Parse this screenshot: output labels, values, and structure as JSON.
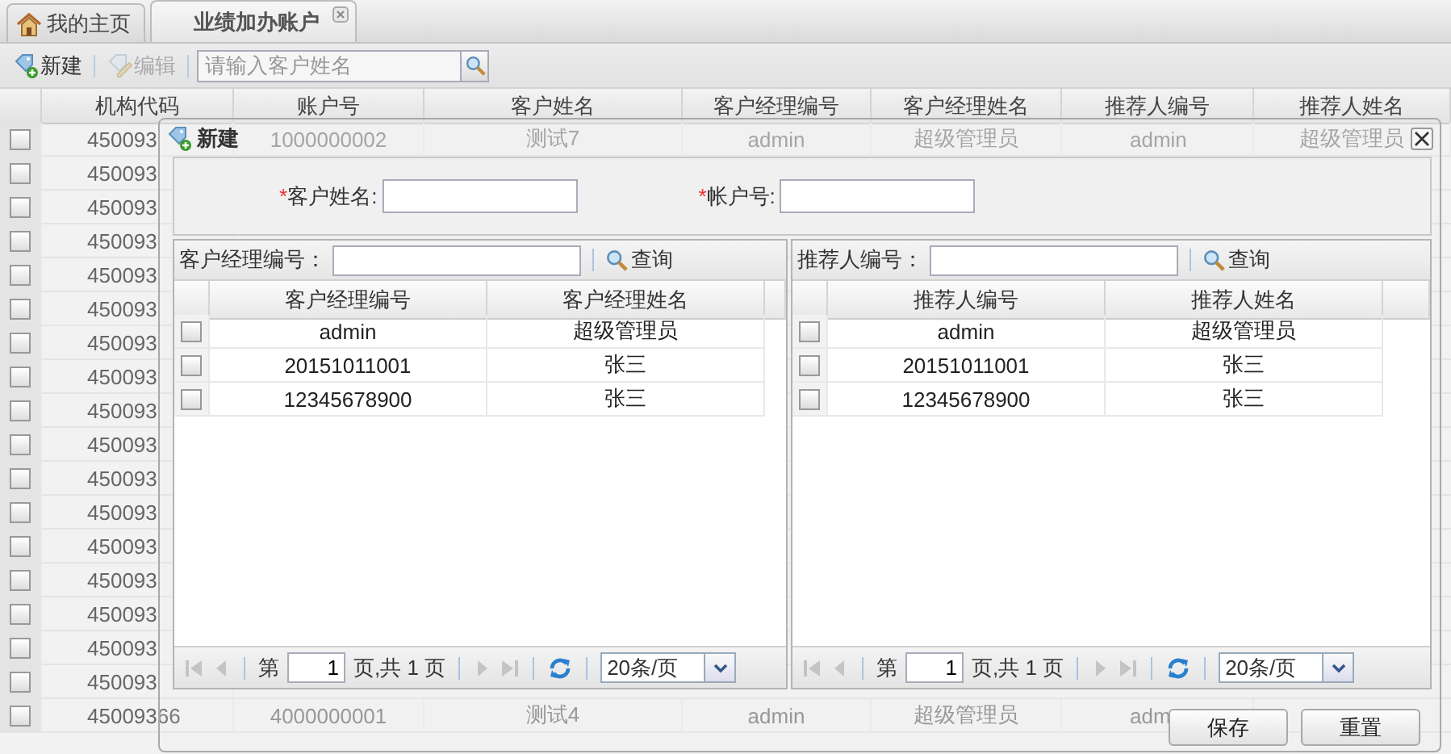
{
  "tabs": [
    {
      "label": "我的主页",
      "selected": false,
      "closable": false
    },
    {
      "label": "业绩加办账户",
      "selected": true,
      "closable": true
    }
  ],
  "toolbar": {
    "buttons": [
      {
        "label": "新建",
        "disabled": false
      },
      {
        "label": "编辑",
        "disabled": true
      }
    ],
    "search": {
      "placeholder": "请输入客户姓名"
    }
  },
  "grid": {
    "columns": [
      "机构代码",
      "账户号",
      "客户姓名",
      "客户经理编号",
      "客户经理姓名",
      "推荐人编号",
      "推荐人姓名"
    ],
    "rows": [
      {
        "checked": false,
        "cells": [
          "450093",
          "1000000002",
          "测试7",
          "admin",
          "超级管理员",
          "admin",
          "超级管理员"
        ]
      },
      {
        "checked": false,
        "cells": [
          "450093"
        ]
      },
      {
        "checked": false,
        "cells": [
          "450093"
        ]
      },
      {
        "checked": false,
        "cells": [
          "450093"
        ]
      },
      {
        "checked": false,
        "cells": [
          "450093"
        ]
      },
      {
        "checked": false,
        "cells": [
          "450093"
        ]
      },
      {
        "checked": false,
        "cells": [
          "450093"
        ]
      },
      {
        "checked": false,
        "cells": [
          "450093"
        ]
      },
      {
        "checked": false,
        "cells": [
          "450093"
        ]
      },
      {
        "checked": false,
        "cells": [
          "450093"
        ]
      },
      {
        "checked": false,
        "cells": [
          "450093"
        ]
      },
      {
        "checked": false,
        "cells": [
          "450093"
        ]
      },
      {
        "checked": false,
        "cells": [
          "450093"
        ]
      },
      {
        "checked": false,
        "cells": [
          "450093"
        ]
      },
      {
        "checked": false,
        "cells": [
          "450093"
        ]
      },
      {
        "checked": false,
        "cells": [
          "450093"
        ]
      },
      {
        "checked": false,
        "cells": [
          "450093"
        ]
      },
      {
        "checked": false,
        "cells": [
          "45009366",
          "4000000001",
          "测试4",
          "admin",
          "超级管理员",
          "adm"
        ]
      }
    ]
  },
  "dialog": {
    "title": "新建",
    "fields": [
      {
        "mark": "*",
        "label": "客户姓名:"
      },
      {
        "mark": "*",
        "label": "帐户号:"
      }
    ],
    "pickers": [
      {
        "search_label": "客户经理编号：",
        "search_button": "查询",
        "columns": [
          "客户经理编号",
          "客户经理姓名"
        ],
        "rows": [
          {
            "checked": false,
            "cells": [
              "admin",
              "超级管理员"
            ]
          },
          {
            "checked": false,
            "cells": [
              "20151011001",
              "张三"
            ]
          },
          {
            "checked": false,
            "cells": [
              "12345678900",
              "张三"
            ]
          }
        ],
        "pager": {
          "prefix": "第",
          "page": "1",
          "suffix": "页,共 1 页",
          "page_size": "20条/页"
        }
      },
      {
        "search_label": "推荐人编号：",
        "search_button": "查询",
        "columns": [
          "推荐人编号",
          "推荐人姓名"
        ],
        "rows": [
          {
            "checked": false,
            "cells": [
              "admin",
              "超级管理员"
            ]
          },
          {
            "checked": false,
            "cells": [
              "20151011001",
              "张三"
            ]
          },
          {
            "checked": false,
            "cells": [
              "12345678900",
              "张三"
            ]
          }
        ],
        "pager": {
          "prefix": "第",
          "page": "1",
          "suffix": "页,共 1 页",
          "page_size": "20条/页"
        }
      }
    ],
    "buttons": [
      "保存",
      "重置"
    ]
  }
}
